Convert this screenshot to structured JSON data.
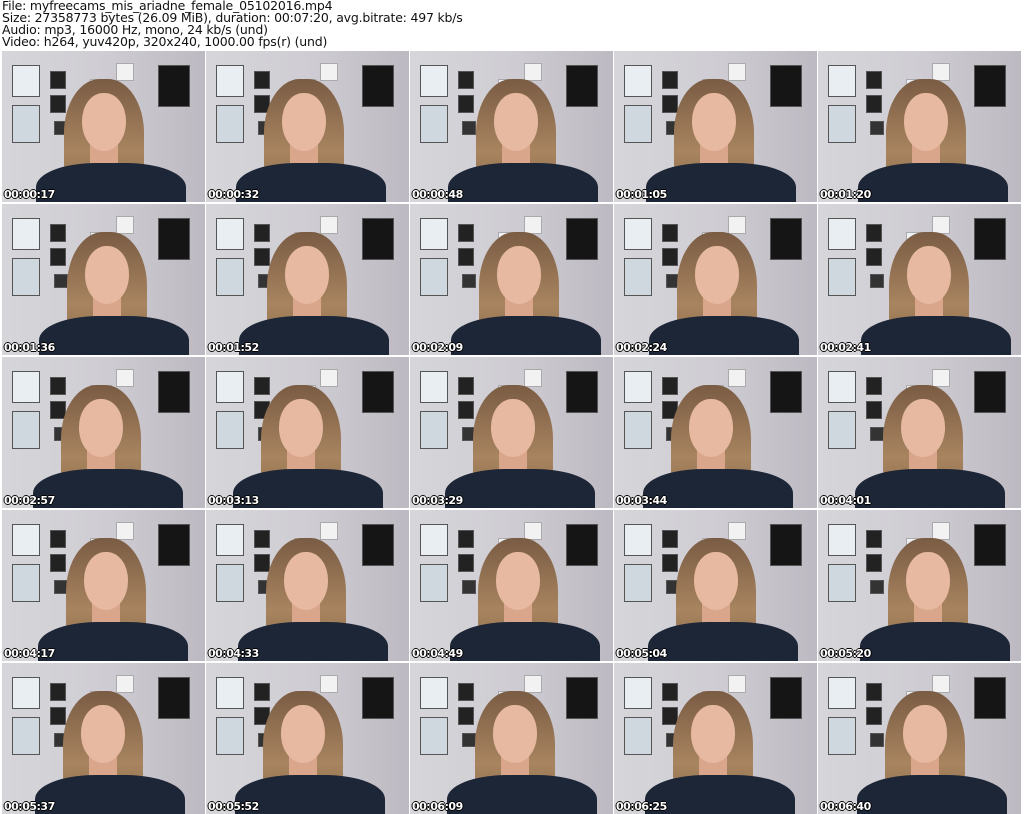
{
  "header": {
    "file": "File: myfreecams_mis_ariadne_female_05102016.mp4",
    "size": "Size: 27358773 bytes (26.09 MiB), duration: 00:07:20, avg.bitrate: 497 kb/s",
    "audio": "Audio: mp3, 16000 Hz, mono, 24 kb/s (und)",
    "video": "Video: h264, yuv420p, 320x240, 1000.00 fps(r) (und)"
  },
  "thumbnails": [
    {
      "timestamp": "00:00:17"
    },
    {
      "timestamp": "00:00:32"
    },
    {
      "timestamp": "00:00:48"
    },
    {
      "timestamp": "00:01:05"
    },
    {
      "timestamp": "00:01:20"
    },
    {
      "timestamp": "00:01:36"
    },
    {
      "timestamp": "00:01:52"
    },
    {
      "timestamp": "00:02:09"
    },
    {
      "timestamp": "00:02:24"
    },
    {
      "timestamp": "00:02:41"
    },
    {
      "timestamp": "00:02:57"
    },
    {
      "timestamp": "00:03:13"
    },
    {
      "timestamp": "00:03:29"
    },
    {
      "timestamp": "00:03:44"
    },
    {
      "timestamp": "00:04:01"
    },
    {
      "timestamp": "00:04:17"
    },
    {
      "timestamp": "00:04:33"
    },
    {
      "timestamp": "00:04:49"
    },
    {
      "timestamp": "00:05:04"
    },
    {
      "timestamp": "00:05:20"
    },
    {
      "timestamp": "00:05:37"
    },
    {
      "timestamp": "00:05:52"
    },
    {
      "timestamp": "00:06:09"
    },
    {
      "timestamp": "00:06:25"
    },
    {
      "timestamp": "00:06:40"
    }
  ]
}
